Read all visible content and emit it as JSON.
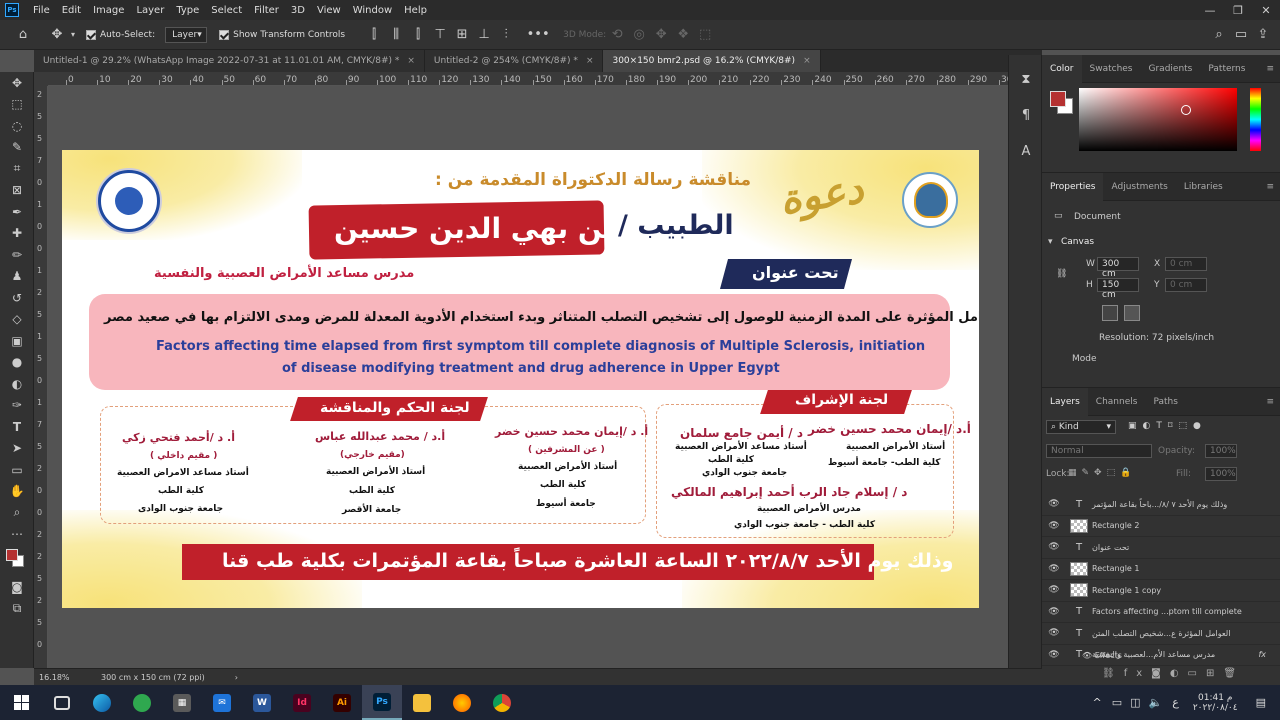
{
  "menubar": {
    "app_icon": "Ps",
    "items": [
      "File",
      "Edit",
      "Image",
      "Layer",
      "Type",
      "Select",
      "Filter",
      "3D",
      "View",
      "Window",
      "Help"
    ]
  },
  "window_controls": {
    "minimize": "—",
    "restore": "❐",
    "close": "✕"
  },
  "options_bar": {
    "auto_select_label": "Auto-Select:",
    "auto_select_value": "Layer",
    "show_transform_label": "Show Transform Controls",
    "mode_3d_label": "3D Mode:",
    "more": "•••"
  },
  "tabs": [
    {
      "label": "Untitled-1 @ 29.2% (WhatsApp Image 2022-07-31 at 11.01.01 AM, CMYK/8#) *",
      "close": "×"
    },
    {
      "label": "Untitled-2 @ 254% (CMYK/8#) *",
      "close": "×"
    },
    {
      "label": "300×150 bmr2.psd @ 16.2% (CMYK/8#)",
      "close": "×"
    }
  ],
  "ruler_h": [
    "0",
    "10",
    "20",
    "30",
    "40",
    "50",
    "60",
    "70",
    "80",
    "90",
    "100",
    "110",
    "120",
    "130",
    "140",
    "150",
    "160",
    "170",
    "180",
    "190",
    "200",
    "210",
    "220",
    "230",
    "240",
    "250",
    "260",
    "270",
    "280",
    "290",
    "300"
  ],
  "ruler_v": [
    "2",
    "5",
    "5",
    "7",
    "0",
    "1",
    "0",
    "0",
    "1",
    "2",
    "5",
    "1",
    "5",
    "0",
    "1",
    "7",
    "5",
    "2",
    "0",
    "0",
    "2",
    "2",
    "5",
    "2",
    "5",
    "0"
  ],
  "poster": {
    "invite_word": "دعوة",
    "header_line": "مناقشة رسالة الدكتوراة المقدمة من :",
    "doctor_title": "الطبيب /",
    "doctor_name": "حسين بهي الدين حسين",
    "doctor_role": "مدرس مساعد الأمراض العصبية والنفسية",
    "topic_label": "تحت عنوان",
    "arabic_title": "العوامل المؤثرة على المدة الزمنية للوصول إلى تشخيص التصلب المتناثر وبدء استخدام  الأدوية المعدلة للمرض ومدى الالتزام بها في صعيد مصر",
    "english_title_1": "Factors affecting time elapsed from first symptom till complete diagnosis of Multiple Sclerosis, initiation",
    "english_title_2": "of disease modifying treatment and drug adherence in Upper Egypt",
    "supervision_label": "لجنة الإشراف",
    "judging_label": "لجنة الحكم والمناقشة",
    "supervisors": [
      {
        "name": "أ.د /إيمان محمد حسين خضر",
        "lines": [
          "أستاذ الأمراض العصبية",
          "كلية الطب- جامعة أسيوط"
        ]
      },
      {
        "name": "د / أيمن جامع سلمان",
        "lines": [
          "أستاذ مساعد الأمراض العصبية",
          "كلية الطب",
          "جامعة جنوب الوادي"
        ]
      },
      {
        "name": "د / إسلام جاد الرب أحمد إبراهيم المالكي",
        "lines": [
          "مدرس الأمراض العصبية",
          "كلية الطب - جامعة جنوب الوادي"
        ]
      }
    ],
    "judges": [
      {
        "name": "أ. د /إيمان محمد حسين خضر",
        "tag": "( عن المشرفين )",
        "lines": [
          "أستاذ الأمراض العصبية",
          "كلية الطب",
          "جامعة أسيوط"
        ]
      },
      {
        "name": "أ.د / محمد عبدالله عباس",
        "tag": "(مقيم خارجي)",
        "lines": [
          "أستاذ الأمراض العصبية",
          "كلية الطب",
          "جامعة الأقصر"
        ]
      },
      {
        "name": "أ. د /أحمد فتحي زكي",
        "tag": "( مقيم داخلي )",
        "lines": [
          "أستاذ مساعد الامراض العصبية",
          "كلية الطب",
          "جامعة جنوب الوادى"
        ]
      }
    ],
    "footer": "وذلك يوم الأحد ٢٠٢٢/٨/٧ الساعة العاشرة صباحاً  بقاعة المؤتمرات بكلية طب قنا"
  },
  "color_panel": {
    "tabs": [
      "Color",
      "Swatches",
      "Gradients",
      "Patterns"
    ],
    "fg_color": "#b53232"
  },
  "properties_panel": {
    "tabs": [
      "Properties",
      "Adjustments",
      "Libraries"
    ],
    "doc_label": "Document",
    "canvas_label": "Canvas",
    "w_label": "W",
    "w_value": "300 cm",
    "h_label": "H",
    "h_value": "150 cm",
    "x_label": "X",
    "x_value": "0 cm",
    "y_label": "Y",
    "y_value": "0 cm",
    "resolution": "Resolution: 72 pixels/inch",
    "mode_label": "Mode"
  },
  "layers_panel": {
    "tabs": [
      "Layers",
      "Channels",
      "Paths"
    ],
    "kind_label": "Kind",
    "blend_mode": "Normal",
    "opacity_label": "Opacity:",
    "opacity_value": "100%",
    "lock_label": "Lock:",
    "fill_label": "Fill:",
    "fill_value": "100%",
    "layers": [
      {
        "name": "وذلك يوم الأحد ٧ /٨/...باحاً بقاعة المؤتمر",
        "type": "text"
      },
      {
        "name": "Rectangle 2",
        "type": "shape"
      },
      {
        "name": "تحت عنوان",
        "type": "text"
      },
      {
        "name": "Rectangle 1",
        "type": "shape"
      },
      {
        "name": "Rectangle 1 copy",
        "type": "shape"
      },
      {
        "name": "Factors affecting ...ptom till complete",
        "type": "text"
      },
      {
        "name": "العوامل المؤثرة ع...شخيص التصلب المتن",
        "type": "text"
      },
      {
        "name": "مدرس مساعد الأم...لعصبية والنفسية",
        "type": "text",
        "fx": "fx"
      }
    ],
    "effects_label": "Effects"
  },
  "status": {
    "zoom": "16.18%",
    "doc_size": "300 cm x 150 cm (72 ppi)"
  },
  "taskbar": {
    "time": "01:41 م",
    "date": "٢٠٢٢/٠٨/٠٤",
    "lang": "ع"
  }
}
